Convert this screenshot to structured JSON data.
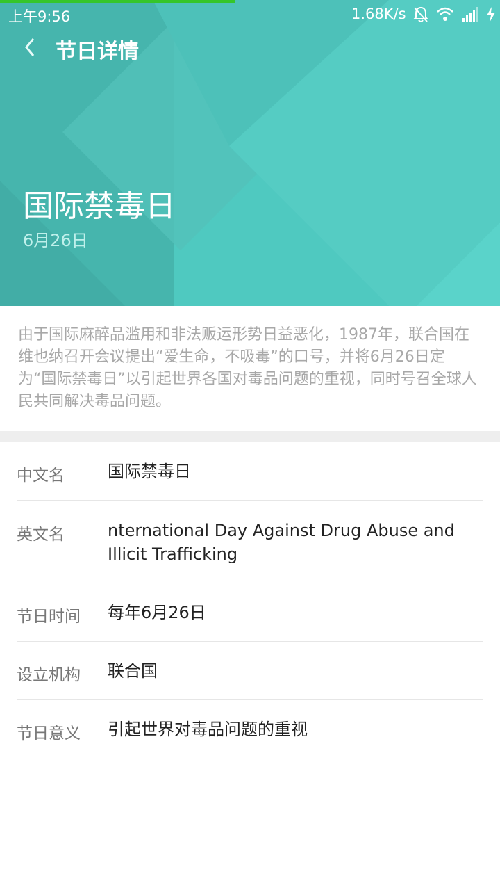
{
  "status_bar": {
    "time": "上午9:56",
    "net_speed": "1.68K/s",
    "icons": [
      "mute-bell-icon",
      "wifi-icon",
      "signal-icon",
      "charging-icon"
    ]
  },
  "header": {
    "title": "节日详情"
  },
  "festival": {
    "name": "国际禁毒日",
    "date": "6月26日",
    "description": "由于国际麻醉品滥用和非法贩运形势日益恶化，1987年，联合国在维也纳召开会议提出“爱生命，不吸毒”的口号，并将6月26日定为“国际禁毒日”以引起世界各国对毒品问题的重视，同时号召全球人民共同解决毒品问题。"
  },
  "details": [
    {
      "label": "中文名",
      "value": "国际禁毒日"
    },
    {
      "label": "英文名",
      "value": "nternational Day Against Drug Abuse and Illicit Trafficking"
    },
    {
      "label": "节日时间",
      "value": "每年6月26日"
    },
    {
      "label": "设立机构",
      "value": "联合国"
    },
    {
      "label": "节日意义",
      "value": "引起世界对毒品问题的重视"
    }
  ],
  "colors": {
    "hero": "#4fc9c0",
    "progress": "#35c62a"
  },
  "page_load_progress": 0.47
}
